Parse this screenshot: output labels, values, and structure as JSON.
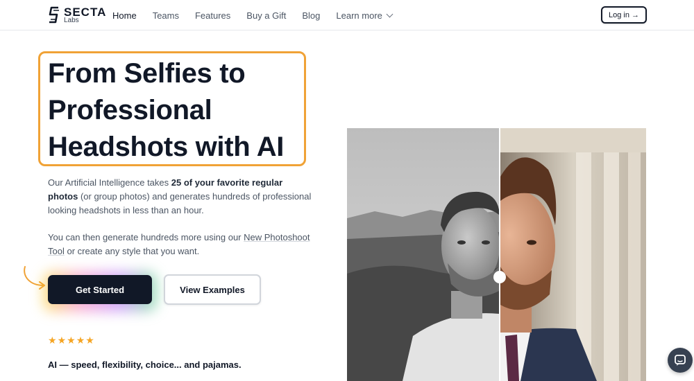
{
  "brand": {
    "name": "SECTA",
    "sub": "Labs",
    "icon": "secta-s-logo"
  },
  "nav": {
    "items": [
      {
        "label": "Home",
        "active": true
      },
      {
        "label": "Teams"
      },
      {
        "label": "Features"
      },
      {
        "label": "Buy a Gift"
      },
      {
        "label": "Blog"
      },
      {
        "label": "Learn more",
        "dropdown": true
      }
    ],
    "login_label": "Log in →"
  },
  "hero": {
    "headline": "From Selfies to Professional Headshots with AI",
    "para1": {
      "pre": "Our Artificial Intelligence takes ",
      "bold": "25 of your favorite regular photos",
      "post": " (or group photos) and generates hundreds of professional looking headshots in less than an hour."
    },
    "para2": {
      "pre": "You can then generate hundreds more using our ",
      "link": "New Photoshoot Tool",
      "post": " or create any style that you want."
    },
    "primary_button": "Get Started",
    "secondary_button": "View Examples",
    "rating": {
      "stars": 5,
      "icon": "star-icon"
    },
    "tagline": "AI — speed, flexibility, choice... and pajamas."
  },
  "compare": {
    "before": "selfie-black-and-white",
    "after": "professional-headshot",
    "slider_position": 0.51
  },
  "chat": {
    "icon": "chat-bubble-icon"
  },
  "colors": {
    "accent": "#f0a236",
    "dark": "#111827",
    "text": "#4b5563",
    "star": "#f5a524"
  }
}
